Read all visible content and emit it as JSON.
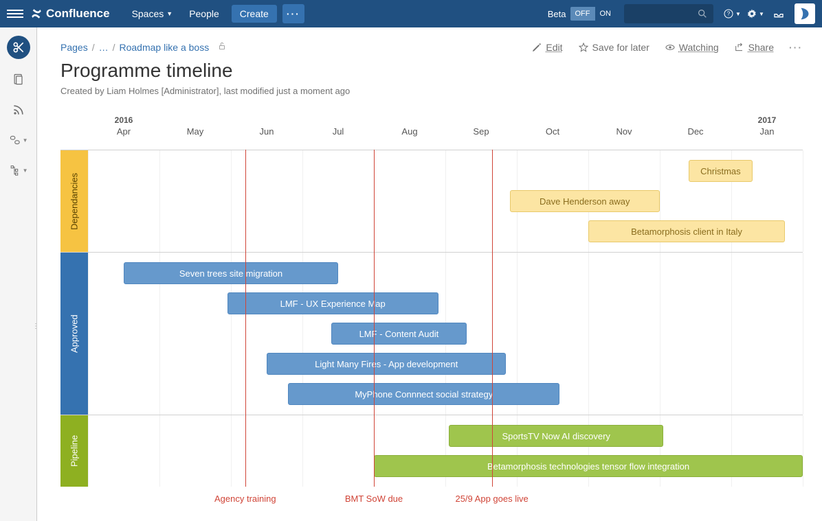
{
  "topnav": {
    "product": "Confluence",
    "spaces": "Spaces",
    "people": "People",
    "create": "Create",
    "beta": "Beta",
    "off": "OFF",
    "on": "ON"
  },
  "breadcrumb": {
    "root": "Pages",
    "ellipsis": "…",
    "current": "Roadmap like a boss"
  },
  "actions": {
    "edit": "Edit",
    "save": "Save for later",
    "watching": "Watching",
    "share": "Share"
  },
  "page": {
    "title": "Programme timeline",
    "byline": "Created by Liam Holmes [Administrator], last modified just a moment ago"
  },
  "chart_data": {
    "type": "gantt",
    "start": "2016-04-01",
    "end": "2017-02-01",
    "months": [
      {
        "label": "Apr",
        "year": "2016",
        "pos": 0
      },
      {
        "label": "May",
        "pos": 1
      },
      {
        "label": "Jun",
        "pos": 2
      },
      {
        "label": "Jul",
        "pos": 3
      },
      {
        "label": "Aug",
        "pos": 4
      },
      {
        "label": "Sep",
        "pos": 5
      },
      {
        "label": "Oct",
        "pos": 6
      },
      {
        "label": "Nov",
        "pos": 7
      },
      {
        "label": "Dec",
        "pos": 8
      },
      {
        "label": "Jan",
        "year": "2017",
        "pos": 9
      }
    ],
    "lanes": [
      {
        "id": "dep",
        "name": "Dependancies",
        "color": "#f6c342",
        "rows": 3,
        "bars": [
          {
            "label": "Christmas",
            "start": 8.4,
            "end": 9.3,
            "row": 0
          },
          {
            "label": "Dave Henderson away",
            "start": 5.9,
            "end": 8.0,
            "row": 1
          },
          {
            "label": "Betamorphosis client in Italy",
            "start": 7.0,
            "end": 9.75,
            "row": 2
          }
        ]
      },
      {
        "id": "app",
        "name": "Approved",
        "color": "#3572b0",
        "rows": 5,
        "bars": [
          {
            "label": "Seven trees site migration",
            "start": 0.5,
            "end": 3.5,
            "row": 0
          },
          {
            "label": "LMF - UX Experience Map",
            "start": 1.95,
            "end": 4.9,
            "row": 1
          },
          {
            "label": "LMF - Content Audit",
            "start": 3.4,
            "end": 5.3,
            "row": 2
          },
          {
            "label": "Light Many Fires - App development",
            "start": 2.5,
            "end": 5.85,
            "row": 3
          },
          {
            "label": "MyPhone Connnect social strategy",
            "start": 2.8,
            "end": 6.6,
            "row": 4
          }
        ]
      },
      {
        "id": "pipe",
        "name": "Pipeline",
        "color": "#8eb021",
        "rows": 2,
        "bars": [
          {
            "label": "SportsTV Now AI discovery",
            "start": 5.05,
            "end": 8.05,
            "row": 0
          },
          {
            "label": "Betamorphosis technologies tensor flow integration",
            "start": 4.0,
            "end": 10.0,
            "row": 1
          }
        ]
      }
    ],
    "markers": [
      {
        "label": "Agency training",
        "pos": 2.2
      },
      {
        "label": "BMT SoW due",
        "pos": 4.0
      },
      {
        "label": "25/9 App goes live",
        "pos": 5.65,
        "wrap": true
      }
    ]
  }
}
